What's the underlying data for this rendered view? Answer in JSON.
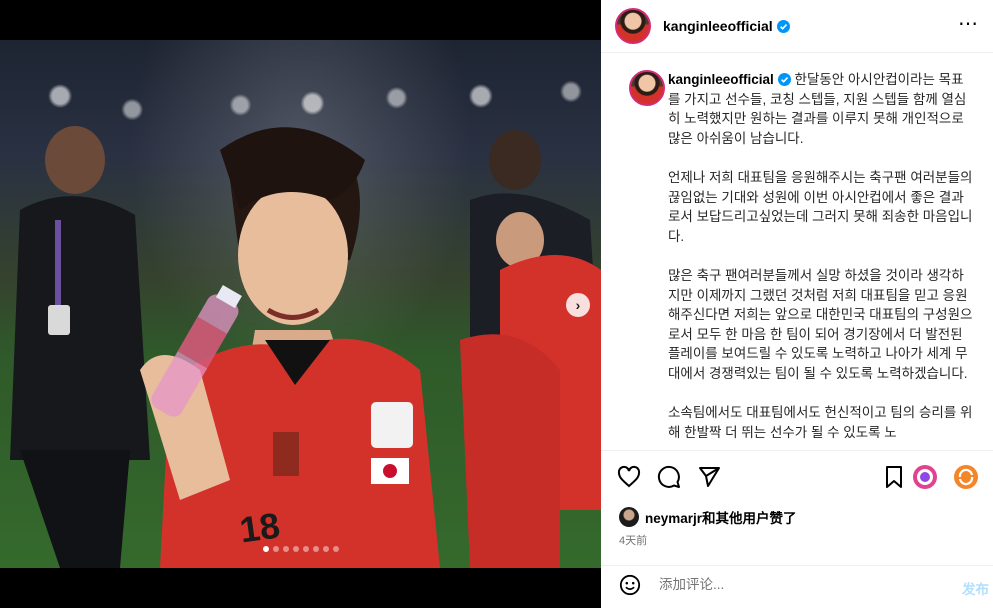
{
  "header": {
    "username": "kanginleeofficial",
    "more_icon": "more-icon"
  },
  "caption": {
    "username": "kanginleeofficial",
    "paragraphs": [
      "한달동안 아시안컵이라는 목표를 가지고 선수들, 코칭 스텝들, 지원 스텝들 함께 열심히 노력했지만 원하는 결과를 이루지 못해 개인적으로 많은 아쉬움이 남습니다.",
      "언제나 저희 대표팀을 응원해주시는 축구팬 여러분들의 끊임없는 기대와 성원에 이번 아시안컵에서 좋은 결과로서 보답드리고싶었는데 그러지 못해 죄송한 마음입니다.",
      "많은 축구 팬여러분들께서 실망 하셨을 것이라 생각하지만 이제까지 그랬던 것처럼 저희 대표팀을 믿고 응원해주신다면 저희는 앞으로 대한민국 대표팀의 구성원으로서 모두 한 마음 한 팀이 되어 경기장에서 더 발전된 플레이를 보여드릴 수 있도록 노력하고 나아가 세계 무대에서 경쟁력있는 팀이 될 수 있도록 노력하겠습니다.",
      "소속팀에서도 대표팀에서도 헌신적이고 팀의 승리를 위해 한발짝 더 뛰는 선수가 될 수 있도록 노"
    ]
  },
  "likes": {
    "text": "neymarjr和其他用户赞了"
  },
  "time_ago": "4天前",
  "comment": {
    "placeholder": "添加评论...",
    "post_label": "发布"
  },
  "media": {
    "slide_count": 8,
    "active_slide": 0
  },
  "colors": {
    "accent": "#0095f6",
    "post_disabled": "#b2dffc",
    "jersey": "#d3322b"
  }
}
